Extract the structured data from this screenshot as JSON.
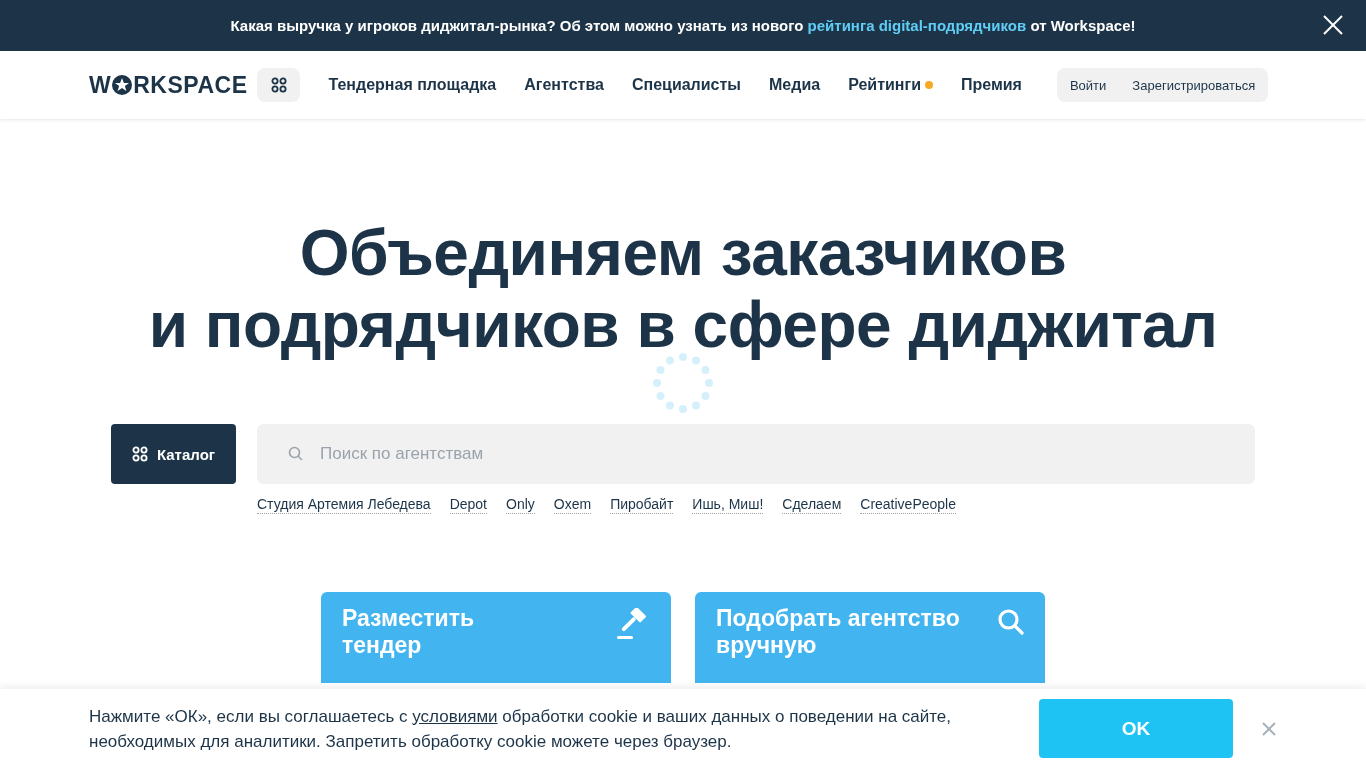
{
  "announcement": {
    "before": "Какая выручка у игроков диджитал-рынка? Об этом можно узнать из нового ",
    "link": "рейтинга digital-подрядчиков",
    "after": " от Workspace!"
  },
  "logo": {
    "start": "W",
    "end": "RKSPACE"
  },
  "nav": [
    {
      "label": "Тендерная площадка",
      "badge": false
    },
    {
      "label": "Агентства",
      "badge": false
    },
    {
      "label": "Специалисты",
      "badge": false
    },
    {
      "label": "Медиа",
      "badge": false
    },
    {
      "label": "Рейтинги",
      "badge": true
    },
    {
      "label": "Премия",
      "badge": false
    }
  ],
  "auth": [
    "Войти",
    "Зарегистрироваться"
  ],
  "hero": {
    "title_lines": [
      "Объединяем заказчиков",
      "и подрядчиков в сфере диджитал"
    ]
  },
  "catalog_button": "Каталог",
  "search": {
    "placeholder": "Поиск по агентствам"
  },
  "tags": [
    "Студия Артемия Лебедева",
    "Depot",
    "Only",
    "Oxem",
    "Пиробайт",
    "Ишь, Миш!",
    "Сделаем",
    "CreativePeople"
  ],
  "cards": [
    {
      "kind": "gavel",
      "title_lines": [
        "Разместить",
        "тендер"
      ]
    },
    {
      "kind": "search",
      "title_lines": [
        "Подобрать агентство",
        "вручную"
      ]
    }
  ],
  "cookie": {
    "before": "Нажмите «ОК», если вы соглашаетесь с ",
    "link": "условиями",
    "after": " обработки cookie и ваших данных о поведении на сайте, необходимых для аналитики. Запретить обработку cookie можете через браузер.",
    "button": "OK"
  }
}
